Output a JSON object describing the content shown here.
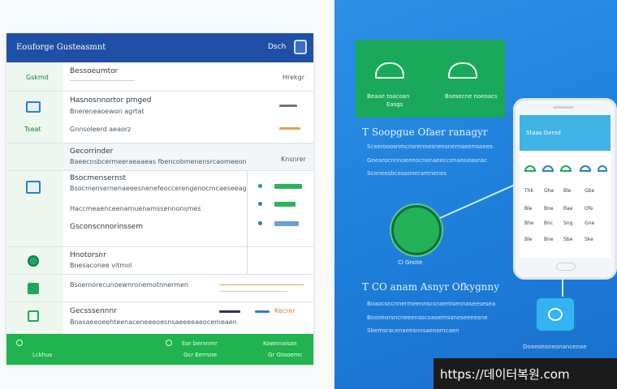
{
  "panel": {
    "title": "Eouforge Gusteasmnt",
    "code": "Dsch"
  },
  "rows": [
    {
      "left": "Gskmd",
      "text": "Bessoeumtor",
      "sub": "",
      "right": "Hrekgr"
    },
    {
      "left": "",
      "text": "Hasnosnnortor pmged",
      "sub": "Bnereneaoewon agrtat",
      "right": ""
    },
    {
      "left": "Tseat",
      "text": "Gnnsoleerd aeaorz",
      "sub": "",
      "right": ""
    },
    {
      "left": "",
      "text": "Gecorrinder",
      "sub": "Baeecnsbcermeeraeaaeas fbencobmenensrcaomeeon",
      "right": "Knsnrer"
    },
    {
      "left": "",
      "text": "Bsocmensernst",
      "sub": "Bsocmensernenaeeesnenefeoccerengenocmcaeseeag",
      "right": ""
    },
    {
      "left": "",
      "text": "Gsconscnnorinssem",
      "sub": "Haccmeaenceenamuenamssennonsmes",
      "right": ""
    },
    {
      "left": "",
      "text": "Hnotorsnr",
      "sub": "Bnesaconee vitmol",
      "right": ""
    },
    {
      "left": "",
      "text": "Bsoemorecunoewnronemotnnermen",
      "sub": "",
      "right": ""
    },
    {
      "left": "",
      "text": "Gecsssennnr",
      "sub": "Bnasaeeoeehteenaceneeeoesnsaeeeeaeocemeaen",
      "right": "Kecrer"
    }
  ],
  "footer": {
    "items": [
      "Lckhus",
      "Eor bernnmr",
      "Kownnaisan"
    ],
    "sub": [
      "",
      "Gcr Eerrsne",
      "Gr Gtooemc"
    ]
  },
  "green_card": {
    "label_left": "Beaae toacoan",
    "sub_left": "Easgs",
    "label_right": "Bsesecne noeoacs"
  },
  "right": {
    "heading1": "T Soopgue Ofaer ranagyr",
    "lines1": [
      "Scxerooosnmcnsrennesnensnernaeemssees",
      "Gnearocnnnoeeeocnonaeeccenaeoeasnac",
      "Sconeesbceasoneramnenes"
    ],
    "logo_label": "Cl Gnote",
    "heading2": "T CO anam Asnyr Ofkygnny",
    "lines2": [
      "Boaocsncnnermeennscsnaemsennaseesesea",
      "Boooeorsncneeenascoaoemsaneseeeesne",
      "Sbemsracenaeesnnsaenomcaen"
    ],
    "bubble_label": "Doaeoeoneonancenae"
  },
  "phone": {
    "title": "Staas Gerod",
    "table_rows": [
      [
        "Thk",
        "Ghe",
        "Ble",
        "Gbe"
      ],
      [
        "Ble",
        "Bne",
        "Rae",
        "Ofe"
      ],
      [
        "Bhe",
        "Bnc",
        "Sng",
        "Gne"
      ],
      [
        "Ble",
        "Bne",
        "Sbe",
        "Ske"
      ]
    ]
  },
  "watermark": "https://데이터복원.com",
  "colors": {
    "header_blue": "#1f4fa6",
    "accent_green": "#20b34f",
    "right_blue": "#1e7fdb"
  }
}
